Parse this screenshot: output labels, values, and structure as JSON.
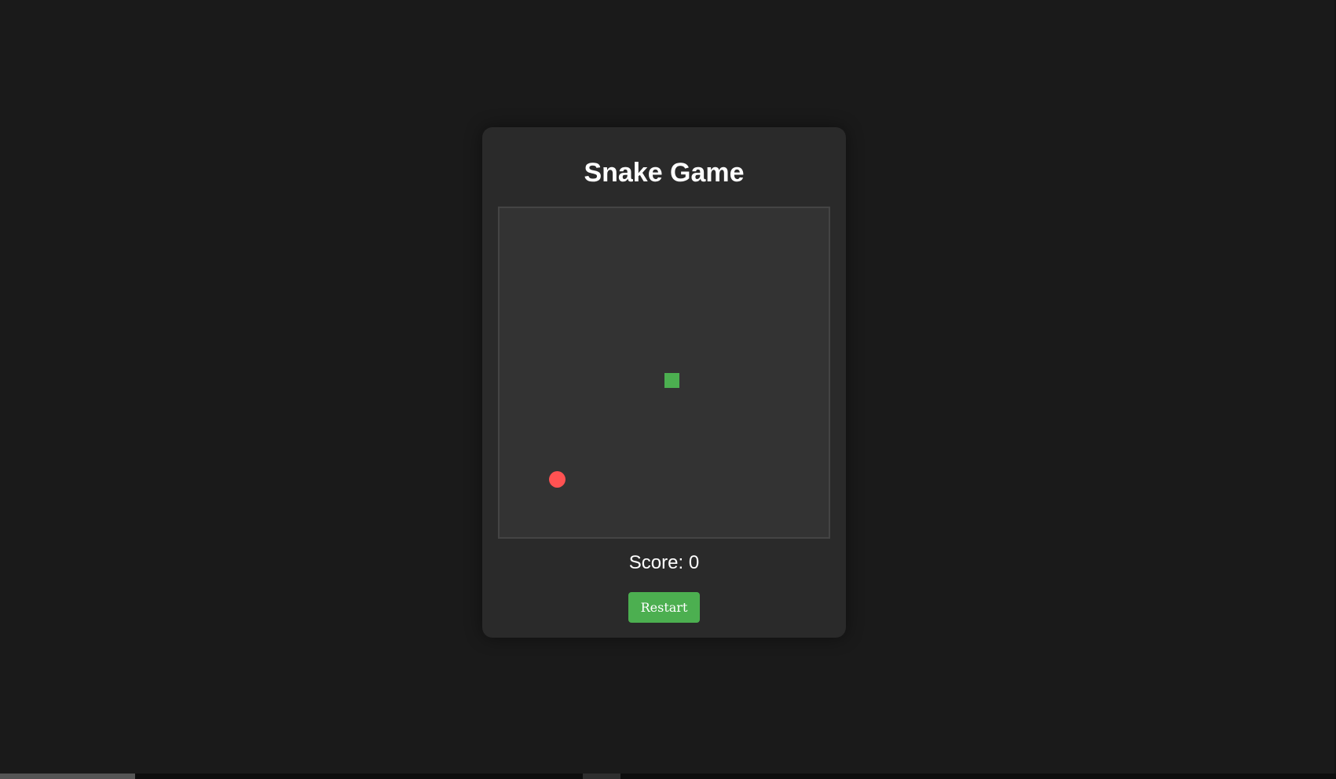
{
  "game": {
    "title": "Snake Game",
    "score_label": "Score: 0",
    "score": 0,
    "restart_label": "Restart",
    "grid": {
      "cells": 20
    },
    "snake": [
      {
        "col": 10,
        "row": 10
      }
    ],
    "food": {
      "col": 3,
      "row": 16
    },
    "colors": {
      "page_background": "#1a1a1a",
      "card_background": "#2a2a2a",
      "board_background": "#333333",
      "snake": "#4caf50",
      "food": "#ff5252",
      "button": "#4caf50",
      "text": "#ffffff"
    }
  }
}
